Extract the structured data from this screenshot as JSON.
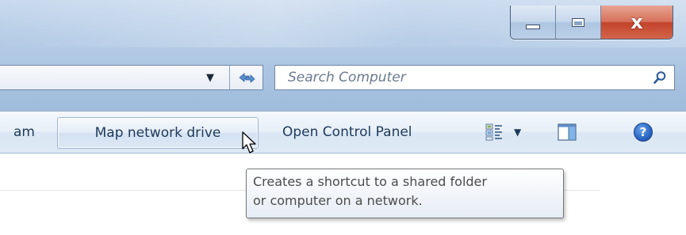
{
  "window": {
    "caption_buttons": {
      "minimize_icon": "minimize-icon",
      "maximize_icon": "maximize-icon",
      "close_glyph": "x"
    }
  },
  "address_bar": {
    "dropdown_icon": "chevron-down-icon",
    "refresh_icon": "refresh-icon"
  },
  "search": {
    "placeholder": "Search Computer",
    "icon": "search-icon"
  },
  "toolbar": {
    "clipped_label": "am",
    "map_network_drive_label": "Map network drive",
    "open_control_panel_label": "Open Control Panel",
    "views_icon": "views-icon",
    "views_dropdown_icon": "chevron-down-icon",
    "preview_pane_icon": "preview-pane-icon",
    "help_icon": "help-icon",
    "help_glyph": "?"
  },
  "tooltip": {
    "line1": "Creates a shortcut to a shared folder",
    "line2": "or computer on a network."
  },
  "colors": {
    "toolbar_text": "#1e395b",
    "close_button": "#c2432b",
    "frame": "#b5cce6"
  }
}
